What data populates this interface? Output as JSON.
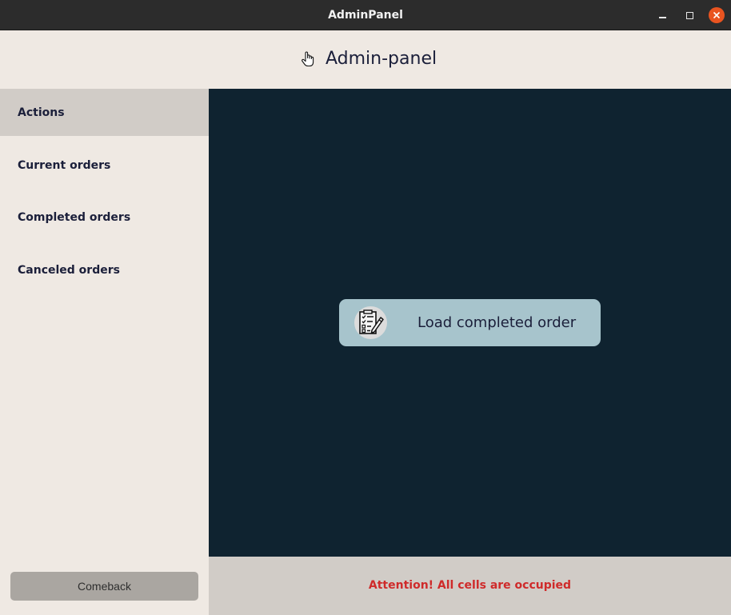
{
  "window": {
    "title": "AdminPanel",
    "controls": {
      "minimize_icon": "minimize-icon",
      "maximize_icon": "maximize-icon",
      "close_icon": "close-icon",
      "close_color": "#e95420"
    }
  },
  "header": {
    "icon": "hand-pointer-icon",
    "title": "Admin-panel"
  },
  "sidebar": {
    "items": [
      {
        "label": "Actions",
        "active": true
      },
      {
        "label": "Current orders",
        "active": false
      },
      {
        "label": "Completed orders",
        "active": false
      },
      {
        "label": "Canceled orders",
        "active": false
      }
    ],
    "comeback_label": "Comeback"
  },
  "main": {
    "load_button": {
      "icon": "checklist-pencil-icon",
      "label": "Load completed order"
    }
  },
  "footer": {
    "status_text": "Attention! All cells are occupied",
    "status_color": "#cf2a2a"
  },
  "colors": {
    "main_background": "#0f2330",
    "sidebar_background": "#efe9e3",
    "active_item_background": "#d1ccc7",
    "button_background": "#a7c4cc"
  }
}
